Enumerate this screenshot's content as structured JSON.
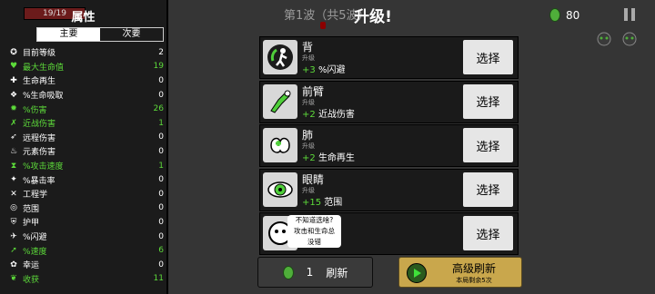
{
  "hud": {
    "hp": "19/19",
    "wave": "第1波（共5波）",
    "currency": "80",
    "title": "升级!"
  },
  "panel": {
    "title": "属性",
    "tabs": [
      "主要",
      "次要"
    ],
    "stats": [
      {
        "name": "目前等级",
        "value": "2",
        "green": false,
        "icon": "level-icon"
      },
      {
        "name": "最大生命值",
        "value": "19",
        "green": true,
        "icon": "heart-icon"
      },
      {
        "name": "生命再生",
        "value": "0",
        "green": false,
        "icon": "regen-icon"
      },
      {
        "name": "%生命吸取",
        "value": "0",
        "green": false,
        "icon": "lifesteal-icon"
      },
      {
        "name": "%伤害",
        "value": "26",
        "green": true,
        "icon": "damage-icon"
      },
      {
        "name": "近战伤害",
        "value": "1",
        "green": true,
        "icon": "melee-icon"
      },
      {
        "name": "远程伤害",
        "value": "0",
        "green": false,
        "icon": "ranged-icon"
      },
      {
        "name": "元素伤害",
        "value": "0",
        "green": false,
        "icon": "elemental-icon"
      },
      {
        "name": "%攻击速度",
        "value": "1",
        "green": true,
        "icon": "attack-speed-icon"
      },
      {
        "name": "%暴击率",
        "value": "0",
        "green": false,
        "icon": "crit-icon"
      },
      {
        "name": "工程学",
        "value": "0",
        "green": false,
        "icon": "engineering-icon"
      },
      {
        "name": "范围",
        "value": "0",
        "green": false,
        "icon": "range-icon"
      },
      {
        "name": "护甲",
        "value": "0",
        "green": false,
        "icon": "armor-icon"
      },
      {
        "name": "%闪避",
        "value": "0",
        "green": false,
        "icon": "dodge-icon"
      },
      {
        "name": "%速度",
        "value": "6",
        "green": true,
        "icon": "speed-icon"
      },
      {
        "name": "幸运",
        "value": "0",
        "green": false,
        "icon": "luck-icon"
      },
      {
        "name": "收获",
        "value": "11",
        "green": true,
        "icon": "harvest-icon"
      }
    ]
  },
  "cards": [
    {
      "name": "背",
      "tag": "升级",
      "bonus": "+3",
      "stat": "%闪避",
      "icon": "back-icon"
    },
    {
      "name": "前臂",
      "tag": "升级",
      "bonus": "+2",
      "stat": "近战伤害",
      "icon": "forearm-icon"
    },
    {
      "name": "肺",
      "tag": "升级",
      "bonus": "+2",
      "stat": "生命再生",
      "icon": "lungs-icon"
    },
    {
      "name": "眼睛",
      "tag": "升级",
      "bonus": "+15",
      "stat": "范围",
      "icon": "eyes-icon"
    }
  ],
  "select_label": "选择",
  "tip": [
    "不知道选啥?",
    "攻击和生命总",
    "没错"
  ],
  "refresh": {
    "cost": "1",
    "label": "刷新"
  },
  "advanced": {
    "label": "高级刷新",
    "remaining": "本局剩余5次"
  }
}
